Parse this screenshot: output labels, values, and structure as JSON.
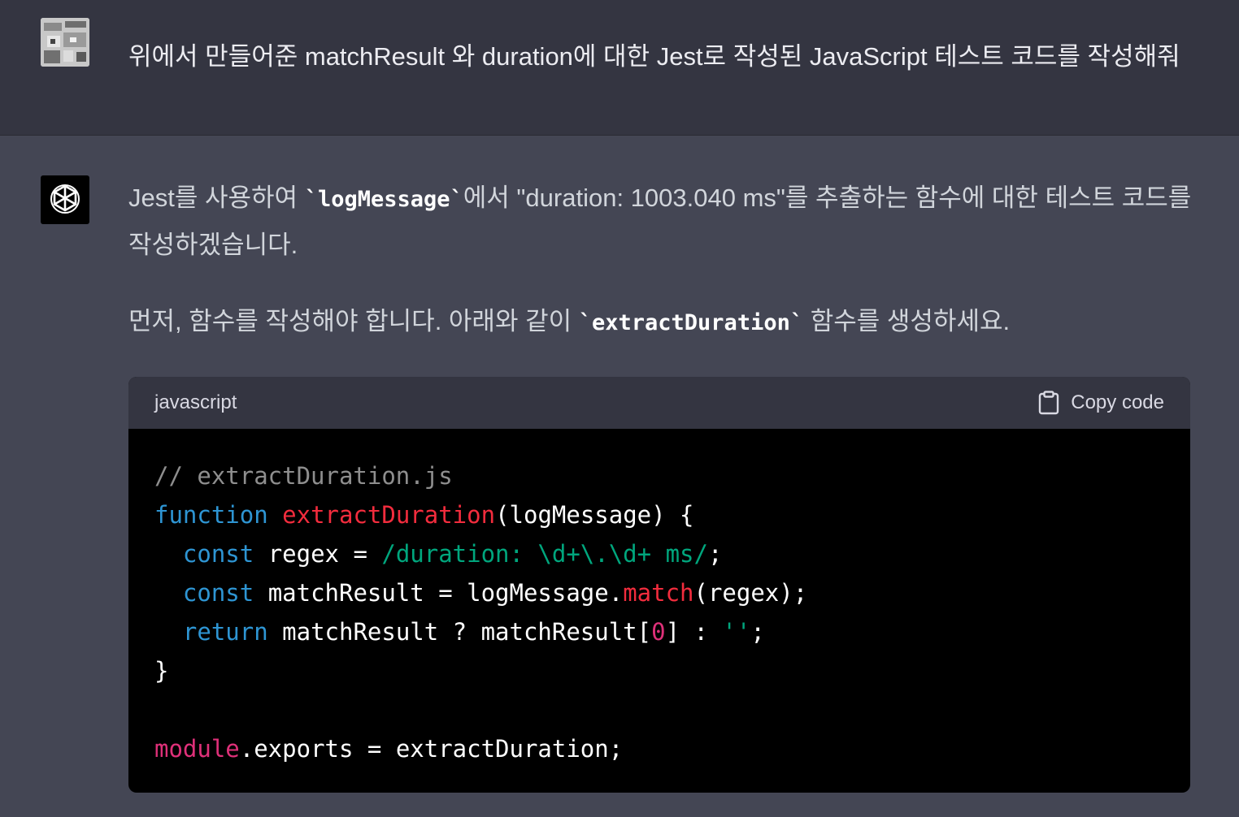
{
  "user_message": {
    "text": "위에서 만들어준 matchResult 와 duration에 대한 Jest로 작성된 JavaScript 테스트 코드를 작성해줘"
  },
  "assistant_message": {
    "paragraph1": {
      "before": "Jest를 사용하여 ",
      "code": "`logMessage`",
      "after": "에서 \"duration: 1003.040 ms\"를 추출하는 함수에 대한 테스트 코드를 작성하겠습니다."
    },
    "paragraph2": {
      "before": "먼저, 함수를 작성해야 합니다. 아래와 같이 ",
      "code": "`extractDuration`",
      "after": " 함수를 생성하세요."
    },
    "code_block": {
      "language": "javascript",
      "copy_label": "Copy code",
      "lines": {
        "l1": "// extractDuration.js",
        "l2_kw": "function",
        "l2_fn": "extractDuration",
        "l2_rest": "(logMessage) {",
        "l3_indent": "  ",
        "l3_kw": "const",
        "l3_mid": " regex = ",
        "l3_regex": "/duration: \\d+\\.\\d+ ms/",
        "l3_end": ";",
        "l4_indent": "  ",
        "l4_kw": "const",
        "l4_mid": " matchResult = logMessage.",
        "l4_fn": "match",
        "l4_end": "(regex);",
        "l5_indent": "  ",
        "l5_kw": "return",
        "l5_mid": " matchResult ? matchResult[",
        "l5_num": "0",
        "l5_mid2": "] : ",
        "l5_str": "''",
        "l5_end": ";",
        "l6": "}",
        "l8_mod": "module",
        "l8_rest": ".exports = extractDuration;"
      }
    }
  },
  "colors": {
    "user_bg": "#343541",
    "assistant_bg": "#444654",
    "code_bg": "#000000",
    "keyword": "#2e95d3",
    "function_name": "#f22c3d",
    "string": "#00a67d",
    "number": "#df3079",
    "comment": "#8e8e8e"
  },
  "icons": {
    "user_avatar": "user-avatar-image",
    "assistant_avatar": "openai-logo-icon",
    "copy": "clipboard-icon"
  }
}
